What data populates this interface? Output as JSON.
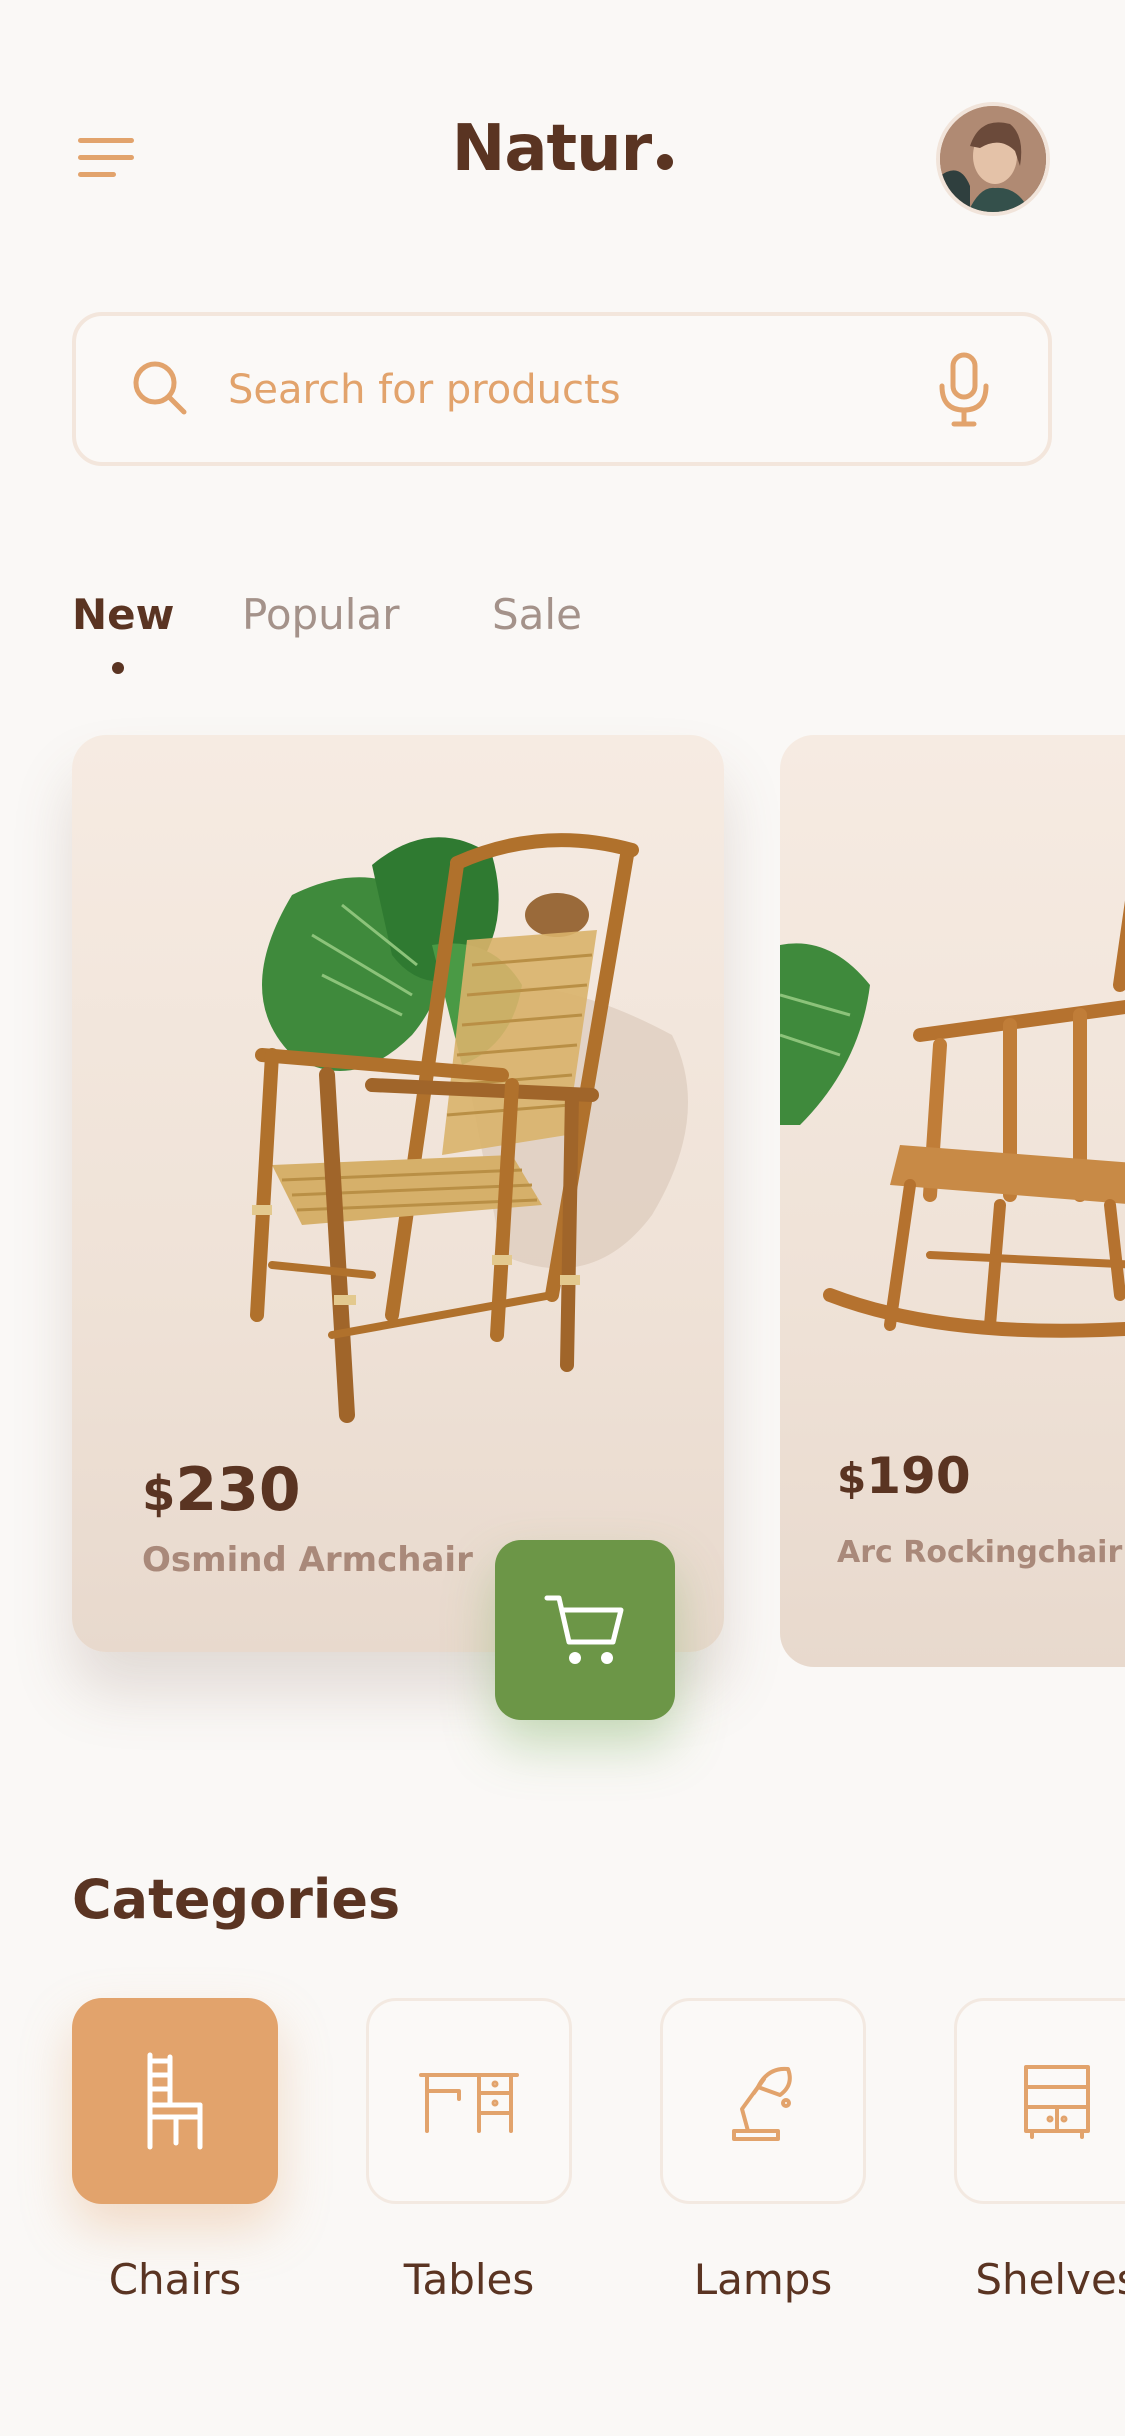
{
  "header": {
    "title": "Natur",
    "menu_icon": "menu-icon",
    "avatar_alt": "profile photo"
  },
  "search": {
    "placeholder": "Search for products",
    "value": "",
    "search_icon": "search-icon",
    "mic_icon": "microphone-icon"
  },
  "tabs": [
    {
      "label": "New",
      "active": true
    },
    {
      "label": "Popular",
      "active": false
    },
    {
      "label": "Sale",
      "active": false
    }
  ],
  "products": [
    {
      "currency": "$",
      "price": "230",
      "name": "Osmind Armchair"
    },
    {
      "currency": "$",
      "price": "190",
      "name": "Arc Rockingchair"
    }
  ],
  "cart_icon": "cart-icon",
  "categories": {
    "title": "Categories",
    "items": [
      {
        "label": "Chairs",
        "icon": "chair-icon",
        "active": true
      },
      {
        "label": "Tables",
        "icon": "table-icon",
        "active": false
      },
      {
        "label": "Lamps",
        "icon": "lamp-icon",
        "active": false
      },
      {
        "label": "Shelves",
        "icon": "shelves-icon",
        "active": false
      }
    ]
  },
  "colors": {
    "background": "#faf8f6",
    "brand_brown": "#5a3422",
    "accent_orange": "#e2a36c",
    "cart_green": "#6c9647",
    "muted_text": "#a4928a"
  }
}
